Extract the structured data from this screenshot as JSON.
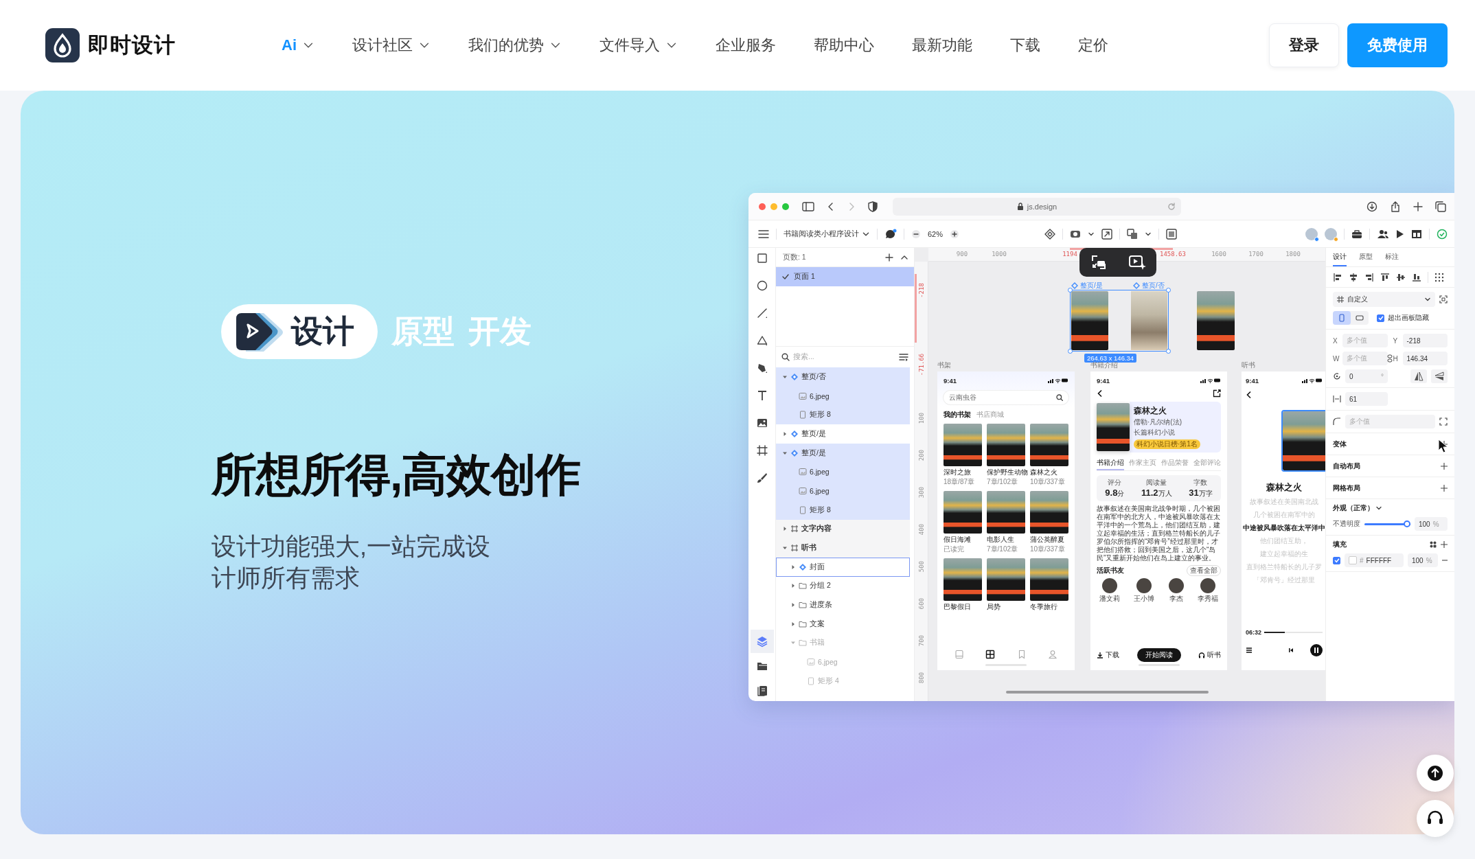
{
  "nav": {
    "logo": "即时设计",
    "items": [
      {
        "label": "Ai",
        "dropdown": true,
        "selected": true
      },
      {
        "label": "设计社区",
        "dropdown": true,
        "selected": false
      },
      {
        "label": "我们的优势",
        "dropdown": true,
        "selected": false
      },
      {
        "label": "文件导入",
        "dropdown": true,
        "selected": false
      },
      {
        "label": "企业服务",
        "dropdown": false,
        "selected": false
      },
      {
        "label": "帮助中心",
        "dropdown": false,
        "selected": false
      },
      {
        "label": "最新功能",
        "dropdown": false,
        "selected": false
      },
      {
        "label": "下载",
        "dropdown": false,
        "selected": false
      },
      {
        "label": "定价",
        "dropdown": false,
        "selected": false
      }
    ],
    "login": "登录",
    "cta": "免费使用"
  },
  "hero": {
    "modes": [
      {
        "label": "设计",
        "selected": true
      },
      {
        "label": "原型",
        "selected": false
      },
      {
        "label": "开发",
        "selected": false
      }
    ],
    "headline": "所想所得,高效创作",
    "subtitle": "设计功能强大,一站完成设计师所有需求"
  },
  "app": {
    "browser": {
      "url": "js.design"
    },
    "toolbar": {
      "file_name": "书籍阅读类小程序设计",
      "zoom": "62%",
      "collaborators": [
        {
          "color": "#2f8cff"
        },
        {
          "color": "#f5a623"
        }
      ]
    },
    "layers": {
      "page_count": "页数: 1",
      "pages": [
        {
          "label": "页面 1",
          "selected": true
        }
      ],
      "search_placeholder": "搜索...",
      "tree": [
        {
          "label": "整页/否",
          "kind": "component",
          "expanded": true,
          "selected": true,
          "children": [
            {
              "label": "6.jpeg",
              "kind": "image",
              "selected": true
            },
            {
              "label": "矩形 8",
              "kind": "rect",
              "selected": true
            }
          ]
        },
        {
          "label": "整页/是",
          "kind": "component",
          "expanded": false,
          "selected": false
        },
        {
          "label": "整页/是",
          "kind": "component",
          "expanded": true,
          "selected": true,
          "children": [
            {
              "label": "6.jpeg",
              "kind": "image",
              "selected": true
            },
            {
              "label": "6.jpeg",
              "kind": "image",
              "selected": true
            },
            {
              "label": "矩形 8",
              "kind": "rect",
              "selected": true
            }
          ]
        },
        {
          "label": "文字内容",
          "kind": "frame",
          "expanded": false,
          "selected": false
        },
        {
          "label": "听书",
          "kind": "frame",
          "expanded": true,
          "selected": false,
          "children": [
            {
              "label": "封面",
              "kind": "component",
              "expanded": false,
              "selected": false,
              "hovered": true
            },
            {
              "label": "分组 2",
              "kind": "group",
              "expanded": false,
              "selected": false
            },
            {
              "label": "进度条",
              "kind": "group",
              "expanded": false,
              "selected": false
            },
            {
              "label": "文案",
              "kind": "group",
              "expanded": false,
              "selected": false
            },
            {
              "label": "书籍",
              "kind": "group",
              "expanded": true,
              "selected": false,
              "dimmed": true,
              "children": [
                {
                  "label": "6.jpeg",
                  "kind": "image",
                  "selected": false,
                  "dimmed": true
                },
                {
                  "label": "矩形 4",
                  "kind": "rect",
                  "selected": false,
                  "dimmed": true
                }
              ]
            }
          ]
        }
      ]
    },
    "ruler_top": [
      {
        "label": "900",
        "highlighted": false
      },
      {
        "label": "1000",
        "highlighted": false
      },
      {
        "label": "1194",
        "highlighted": true
      },
      {
        "label": "1458.63",
        "highlighted": true
      },
      {
        "label": "1600",
        "highlighted": false
      },
      {
        "label": "1700",
        "highlighted": false
      },
      {
        "label": "1800",
        "highlighted": false
      }
    ],
    "ruler_left": [
      {
        "label": "-218",
        "highlighted": true
      },
      {
        "label": "-71.66",
        "highlighted": true
      },
      {
        "label": "100",
        "highlighted": false
      },
      {
        "label": "200",
        "highlighted": false
      },
      {
        "label": "300",
        "highlighted": false
      },
      {
        "label": "400",
        "highlighted": false
      },
      {
        "label": "500",
        "highlighted": false
      },
      {
        "label": "600",
        "highlighted": false
      },
      {
        "label": "700",
        "highlighted": false
      },
      {
        "label": "800",
        "highlighted": false
      }
    ],
    "selection": {
      "labels": [
        "整页/是",
        "整页/否"
      ],
      "size": "264.63 x 146.34"
    },
    "shelf": {
      "label": "书架",
      "time": "9:41",
      "search": "云南虫谷",
      "tabs": [
        {
          "label": "我的书架",
          "selected": true
        },
        {
          "label": "书店商城",
          "selected": false
        }
      ],
      "books": [
        {
          "title": "深时之旅",
          "progress": "18章/87章"
        },
        {
          "title": "保护野生动物",
          "progress": "7章/102章"
        },
        {
          "title": "森林之火",
          "progress": "10章/337章"
        },
        {
          "title": "假日海滩",
          "progress": "已读完"
        },
        {
          "title": "电影人生",
          "progress": "7章/102章"
        },
        {
          "title": "蒲公英醉夏",
          "progress": "10章/337章"
        },
        {
          "title": "巴黎假日"
        },
        {
          "title": "局势"
        },
        {
          "title": "冬季旅行"
        }
      ],
      "tabbar": [
        {
          "kind": "book",
          "selected": false
        },
        {
          "kind": "store",
          "selected": true
        },
        {
          "kind": "bookmark",
          "selected": false
        },
        {
          "kind": "profile",
          "selected": false
        }
      ]
    },
    "detail": {
      "label": "书籍介绍",
      "time": "9:41",
      "title": "森林之火",
      "author": "儒勒·凡尔纳(法)",
      "genre": "长篇科幻小说",
      "badge": "科幻小说日榜·第1名",
      "tabs": [
        {
          "label": "书籍介绍",
          "selected": true
        },
        {
          "label": "作家主页",
          "selected": false
        },
        {
          "label": "作品荣誉",
          "selected": false
        },
        {
          "label": "全部评论",
          "selected": false
        }
      ],
      "stats": [
        {
          "label": "评分",
          "value": "9.8",
          "unit": "分"
        },
        {
          "label": "阅读量",
          "value": "11.2",
          "unit": "万人"
        },
        {
          "label": "字数",
          "value": "31",
          "unit": "万字"
        }
      ],
      "summary": "故事叙述在美国南北战争时期，几个被困在南军中的北方人，中途被风暴吹落在太平洋中的一个荒岛上，他们团结互助，建立起幸福的生活；直到格兰特船长的儿子罗伯尔所指挥的“邓肯号”经过那里时，才把他们搭救；回到美国之后，这几个“岛民”又重新开始他们在岛上建立的事业。",
      "friends_label": "活跃书友",
      "see_all": "查看全部",
      "friends": [
        "潘文莉",
        "王小博",
        "李杰",
        "李秀福"
      ],
      "actions": {
        "download": "下载",
        "read": "开始阅读",
        "listen": "听书"
      }
    },
    "listen": {
      "label": "听书",
      "time": "9:41",
      "title": "森林之火",
      "lines": [
        {
          "text": "故事叙述在美国南北战",
          "current": false
        },
        {
          "text": "几个被困在南军中的",
          "current": false
        },
        {
          "text": "中途被风暴吹落在太平洋中",
          "current": true
        },
        {
          "text": "他们团结互助，",
          "current": false
        },
        {
          "text": "建立起幸福的生",
          "current": false
        },
        {
          "text": "直到格兰特船长的儿子罗",
          "current": false
        },
        {
          "text": "「邓肯号」经过那里",
          "current": false
        }
      ],
      "elapsed": "06:32",
      "level": 0.35
    },
    "inspector": {
      "tabs": [
        {
          "label": "设计",
          "selected": true
        },
        {
          "label": "原型",
          "selected": false
        },
        {
          "label": "标注",
          "selected": false
        }
      ],
      "preset": "自定义",
      "orientations": [
        {
          "kind": "portrait",
          "selected": true
        },
        {
          "kind": "landscape",
          "selected": false
        }
      ],
      "clip": {
        "label": "超出画板隐藏",
        "checked": true
      },
      "fields": [
        {
          "label": "X",
          "placeholder": "多个值"
        },
        {
          "label": "Y",
          "value": "-218"
        },
        {
          "label": "W",
          "placeholder": "多个值"
        },
        {
          "label": "H",
          "value": "146.34"
        }
      ],
      "rotation": {
        "value": "0",
        "unit": "°"
      },
      "spacing": "61",
      "radius_placeholder": "多个值",
      "sections": [
        "变体",
        "自动布局",
        "网格布局"
      ],
      "appearance": {
        "label": "外观（正常）",
        "opacity_label": "不透明度",
        "level": 1,
        "value": "100",
        "unit": "%"
      },
      "fill": {
        "label": "填充",
        "checked": true,
        "hash": "#",
        "hex": "FFFFFF",
        "opacity": "100",
        "unit": "%"
      }
    }
  }
}
